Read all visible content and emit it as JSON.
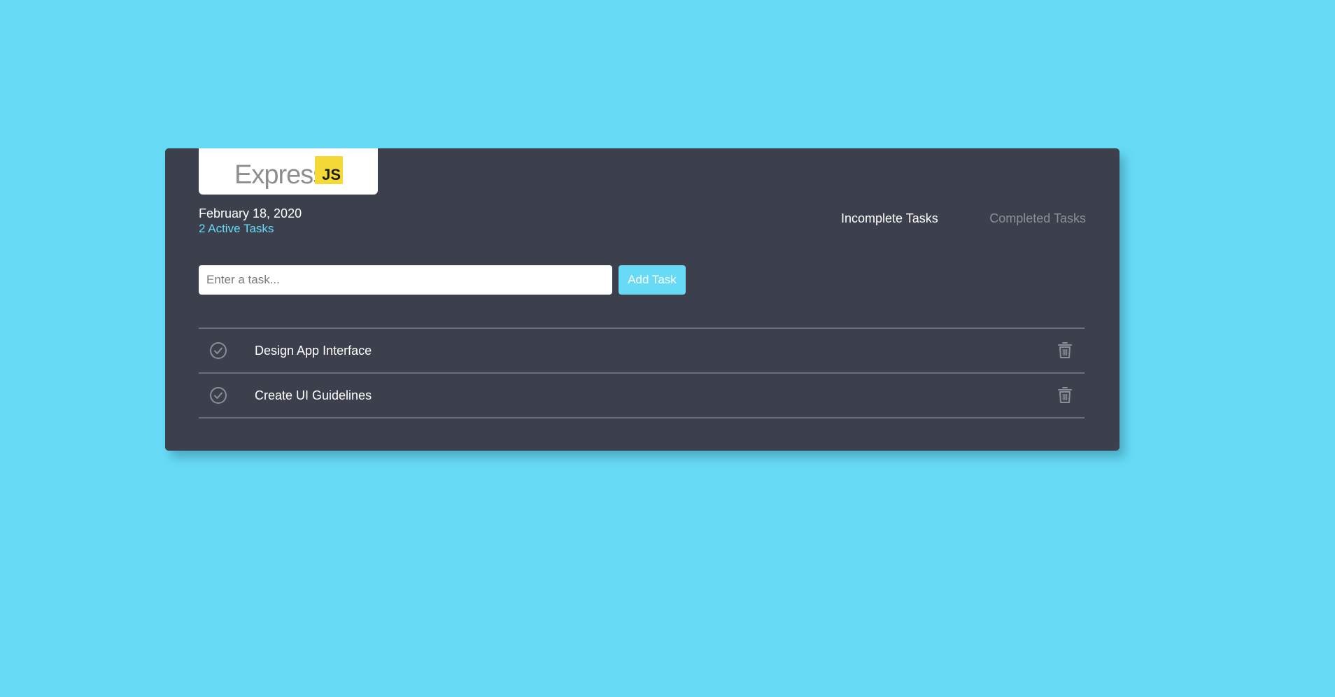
{
  "app": {
    "logo_text": "Express",
    "logo_badge": "JS"
  },
  "header": {
    "date": "February 18, 2020",
    "active_count": "2 Active Tasks"
  },
  "tabs": {
    "incomplete": "Incomplete Tasks",
    "completed": "Completed Tasks",
    "selected": "Incomplete Tasks"
  },
  "new_task": {
    "placeholder": "Enter a task...",
    "value": "",
    "button_label": "Add Task"
  },
  "tasks": [
    {
      "label": "Design App Interface",
      "complete_icon": "check-circle-icon",
      "delete_icon": "trash-icon"
    },
    {
      "label": "Create UI Guidelines",
      "complete_icon": "check-circle-icon",
      "delete_icon": "trash-icon"
    }
  ],
  "colors": {
    "background": "#67dbf6",
    "card": "#3c404c",
    "accent": "#67dbf6",
    "logo_badge": "#f5da37",
    "muted": "#8a8e97",
    "divider": "#6b6f79"
  }
}
